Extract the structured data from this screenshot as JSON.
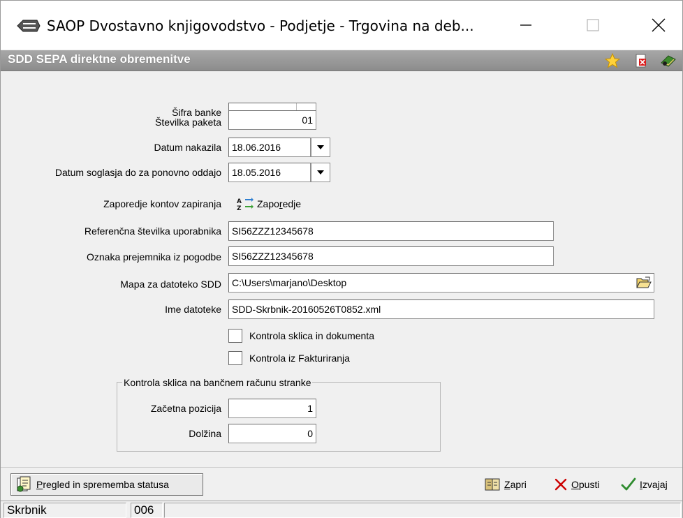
{
  "window": {
    "title": "SAOP Dvostavno knjigovodstvo - Podjetje - Trgovina na deb...",
    "icon": "saop-app-icon",
    "controls": {
      "minimize_icon": "minimize-icon",
      "maximize_icon": "maximize-icon",
      "close_icon": "close-icon"
    }
  },
  "form_header": {
    "title": "SDD SEPA direktne obremenitve",
    "icons": [
      "star-icon",
      "document-delete-icon",
      "book-exit-icon"
    ]
  },
  "form": {
    "sifra_banke": {
      "label": "Šifra banke",
      "value": "",
      "button": "..."
    },
    "stevilka_paketa": {
      "label": "Številka paketa",
      "value": "01"
    },
    "datum_nakazila": {
      "label": "Datum nakazila",
      "value": "18.06.2016"
    },
    "datum_soglasja": {
      "label": "Datum soglasja do za ponovno oddajo",
      "value": "18.05.2016"
    },
    "zaporedje_kontov": {
      "label": "Zaporedje kontov zapiranja",
      "button_prefix": "Zapo",
      "button_underlined": "r",
      "button_suffix": "edje"
    },
    "referencna_stevilka": {
      "label": "Referenčna številka uporabnika",
      "value": "SI56ZZZ12345678"
    },
    "oznaka_prejemnika": {
      "label": "Oznaka prejemnika iz pogodbe",
      "value": "SI56ZZZ12345678"
    },
    "mapa_datoteke": {
      "label": "Mapa za datoteko SDD",
      "value": "C:\\Users\\marjano\\Desktop"
    },
    "ime_datoteke": {
      "label": "Ime datoteke",
      "value": "SDD-Skrbnik-20160526T0852.xml"
    },
    "kontrola_sklica": {
      "label": "Kontrola sklica in dokumenta",
      "checked": false
    },
    "kontrola_fakturiranja": {
      "label": "Kontrola iz Fakturiranja",
      "checked": false
    },
    "group": {
      "title": "Kontrola sklica na bančnem računu stranke",
      "zacetna_pozicija": {
        "label": "Začetna pozicija",
        "value": "1"
      },
      "dolzina": {
        "label": "Dolžina",
        "value": "0"
      }
    }
  },
  "toolbar": {
    "pregled": {
      "underlined": "P",
      "rest": "regled in sprememba statusa"
    },
    "zapri": {
      "underlined": "Z",
      "rest": "apri"
    },
    "opusti": {
      "underlined": "O",
      "rest": "pusti"
    },
    "izvajaj": {
      "underlined": "I",
      "rest": "zvajaj"
    }
  },
  "statusbar": {
    "user": "Skrbnik",
    "code": "006",
    "message": ""
  },
  "colors": {
    "header_bg": "#999999",
    "header_text": "#ffffff",
    "cancel_red": "#cc0000",
    "confirm_green": "#2e8b2e"
  }
}
